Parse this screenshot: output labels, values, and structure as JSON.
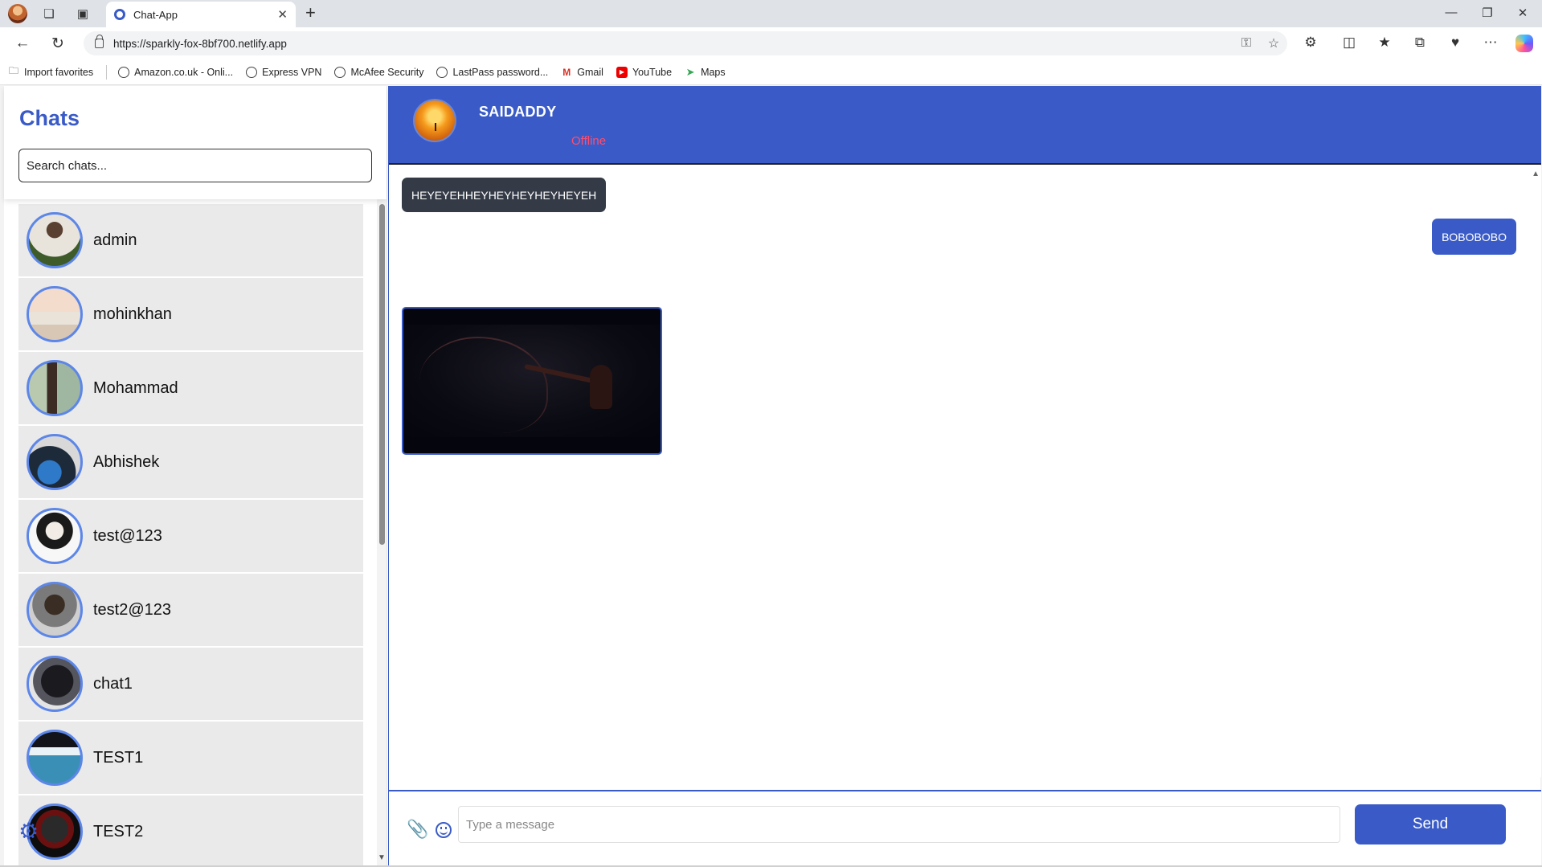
{
  "browser": {
    "tab_title": "Chat-App",
    "url": "https://sparkly-fox-8bf700.netlify.app",
    "bookmarks": [
      {
        "label": "Import favorites",
        "icon": "folder-icon"
      },
      {
        "label": "Amazon.co.uk - Onli...",
        "icon": "globe-icon"
      },
      {
        "label": "Express VPN",
        "icon": "globe-icon"
      },
      {
        "label": "McAfee Security",
        "icon": "globe-icon"
      },
      {
        "label": "LastPass password...",
        "icon": "globe-icon"
      },
      {
        "label": "Gmail",
        "icon": "gmail-icon"
      },
      {
        "label": "YouTube",
        "icon": "youtube-icon"
      },
      {
        "label": "Maps",
        "icon": "maps-icon"
      }
    ]
  },
  "sidebar": {
    "title": "Chats",
    "search_placeholder": "Search chats...",
    "chats": [
      {
        "name": "admin"
      },
      {
        "name": "mohinkhan"
      },
      {
        "name": "Mohammad"
      },
      {
        "name": "Abhishek"
      },
      {
        "name": "test@123"
      },
      {
        "name": "test2@123"
      },
      {
        "name": "chat1"
      },
      {
        "name": "TEST1"
      },
      {
        "name": "TEST2"
      }
    ]
  },
  "conversation": {
    "contact_name": "SAIDADDY",
    "status": "Offline",
    "messages": [
      {
        "direction": "incoming",
        "type": "text",
        "text": "HEYEYEHHEYHEYHEYHEYHEYEH"
      },
      {
        "direction": "outgoing",
        "type": "text",
        "text": "BOBOBOBO"
      },
      {
        "direction": "incoming",
        "type": "image",
        "text": ""
      }
    ]
  },
  "composer": {
    "placeholder": "Type a message",
    "send_label": "Send"
  },
  "colors": {
    "accent": "#3a5bc7",
    "incoming_bubble": "#343a46",
    "offline": "#ff4d6d"
  }
}
